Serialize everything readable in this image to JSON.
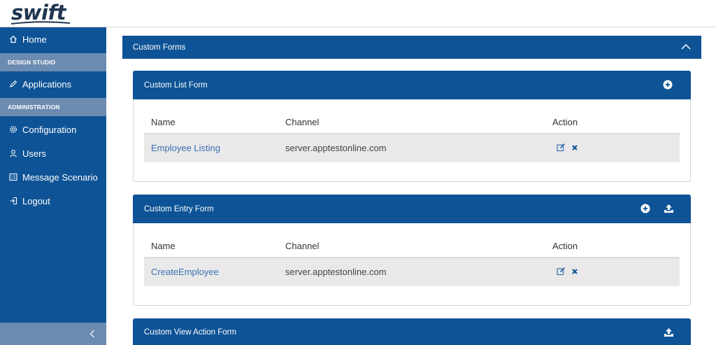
{
  "app": {
    "logo_text": "swift"
  },
  "sidebar": {
    "items": [
      {
        "label": "Home",
        "icon": "home-icon"
      },
      {
        "label": "Applications",
        "icon": "pencil-icon"
      },
      {
        "label": "Configuration",
        "icon": "gear-icon"
      },
      {
        "label": "Users",
        "icon": "user-icon"
      },
      {
        "label": "Message Scenario",
        "icon": "message-list-icon"
      },
      {
        "label": "Logout",
        "icon": "logout-icon"
      }
    ],
    "sections": [
      "DESIGN STUDIO",
      "ADMINISTRATION"
    ],
    "collapse_icon": "chevron-left-icon"
  },
  "main": {
    "title": "Custom Forms",
    "toggle_icon": "chevron-up-icon"
  },
  "list_form": {
    "title": "Custom List Form",
    "columns": [
      "Name",
      "Channel",
      "Action"
    ],
    "rows": [
      {
        "name": "Employee Listing",
        "channel": "server.apptestonline.com"
      }
    ]
  },
  "entry_form": {
    "title": "Custom Entry Form",
    "columns": [
      "Name",
      "Channel",
      "Action"
    ],
    "rows": [
      {
        "name": "CreateEmployee",
        "channel": "server.apptestonline.com"
      }
    ]
  },
  "view_action_form": {
    "title": "Custom View Action Form"
  },
  "colors": {
    "primary": "#0e5396",
    "section": "#6b8bb0",
    "link": "#3a6fb0",
    "row_bg": "#e9e9e9"
  }
}
